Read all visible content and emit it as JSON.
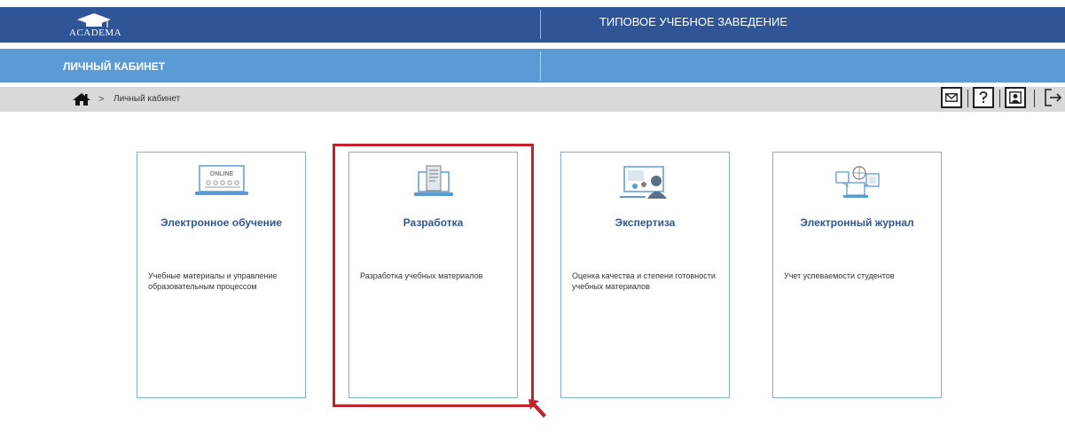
{
  "header": {
    "logo_text": "ACADEMA",
    "org_title": "ТИПОВОЕ УЧЕБНОЕ ЗАВЕДЕНИЕ",
    "section_title": "ЛИЧНЫЙ КАБИНЕТ"
  },
  "breadcrumb": {
    "home_icon": "home-icon",
    "separator": ">",
    "current": "Личный кабинет"
  },
  "toolbar": {
    "icons": [
      "mail-icon",
      "help-icon",
      "profile-icon",
      "logout-icon"
    ]
  },
  "cards": [
    {
      "icon": "online-laptop-icon",
      "icon_text": "ONLINE",
      "title": "Электронное обучение",
      "description": "Учебные материалы и управление образовательным процессом"
    },
    {
      "icon": "document-laptop-icon",
      "title": "Разработка",
      "description": "Разработка учебных материалов"
    },
    {
      "icon": "presentation-icon",
      "title": "Экспертиза",
      "description": "Оценка качества и степени готовности учебных материалов"
    },
    {
      "icon": "network-journal-icon",
      "title": "Электронный журнал",
      "description": "Учет успеваемости студентов"
    }
  ],
  "colors": {
    "header_dark": "#2f5597",
    "header_light": "#5b9bd5",
    "breadcrumb_bg": "#d9d9d9",
    "card_border": "#7eb0de",
    "card_title": "#2f5597",
    "highlight": "#c0232c"
  }
}
